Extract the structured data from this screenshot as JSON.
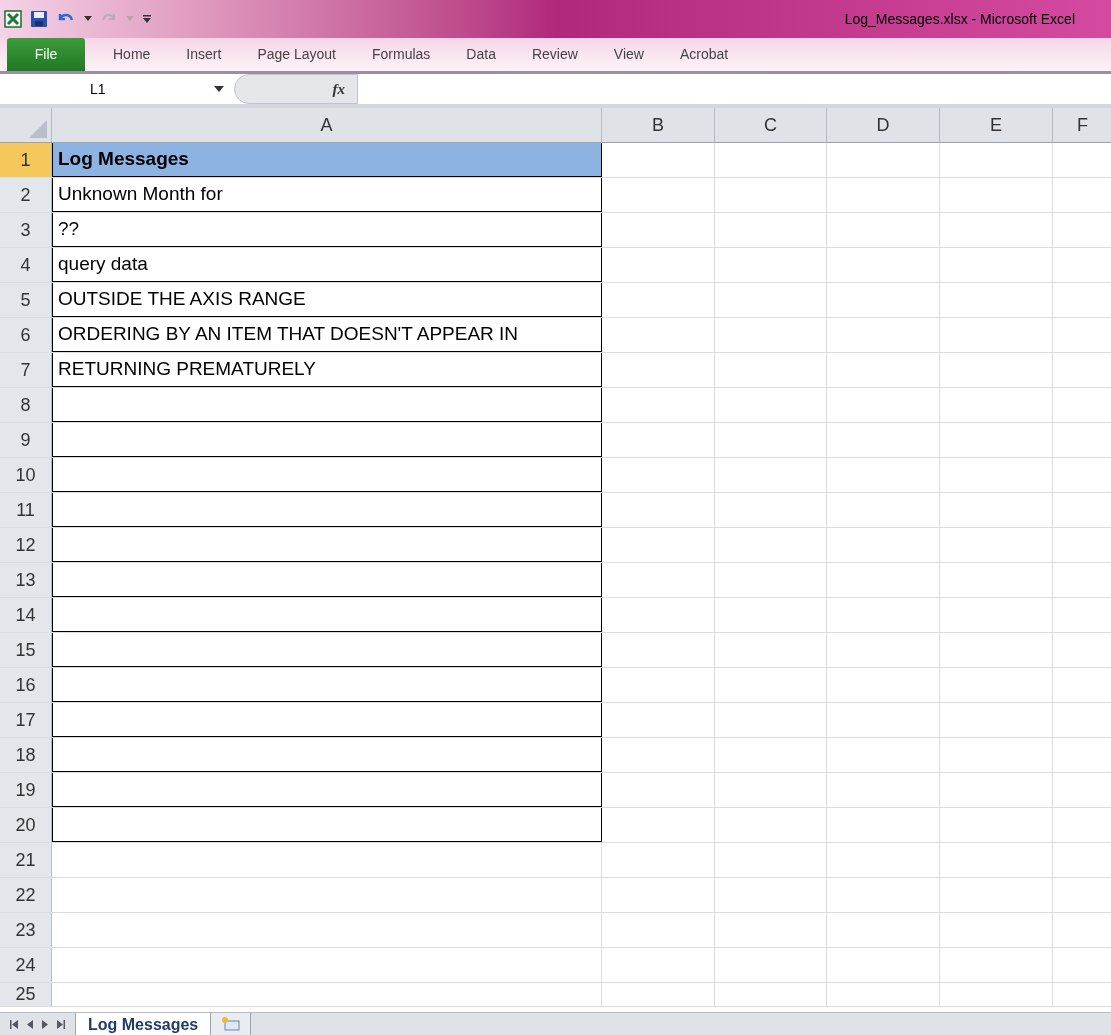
{
  "window": {
    "title": "Log_Messages.xlsx  -  Microsoft Excel"
  },
  "ribbon_tabs": [
    {
      "label": "File",
      "kind": "file",
      "selected": false
    },
    {
      "label": "Home",
      "kind": "tab",
      "selected": false
    },
    {
      "label": "Insert",
      "kind": "tab",
      "selected": false
    },
    {
      "label": "Page Layout",
      "kind": "tab",
      "selected": false
    },
    {
      "label": "Formulas",
      "kind": "tab",
      "selected": false
    },
    {
      "label": "Data",
      "kind": "tab",
      "selected": false
    },
    {
      "label": "Review",
      "kind": "tab",
      "selected": false
    },
    {
      "label": "View",
      "kind": "tab",
      "selected": false
    },
    {
      "label": "Acrobat",
      "kind": "tab",
      "selected": false
    }
  ],
  "formula_bar": {
    "name_box": "L1",
    "function_label": "fx"
  },
  "columns": [
    "A",
    "B",
    "C",
    "D",
    "E",
    "F"
  ],
  "rows": [
    {
      "number": "1",
      "selected": true,
      "header": true,
      "cell_a": "Log Messages",
      "bordered": true
    },
    {
      "number": "2",
      "selected": false,
      "header": false,
      "cell_a": "Unknown Month for",
      "bordered": true
    },
    {
      "number": "3",
      "selected": false,
      "header": false,
      "cell_a": "??",
      "bordered": true
    },
    {
      "number": "4",
      "selected": false,
      "header": false,
      "cell_a": "query data",
      "bordered": true
    },
    {
      "number": "5",
      "selected": false,
      "header": false,
      "cell_a": "OUTSIDE THE AXIS RANGE",
      "bordered": true
    },
    {
      "number": "6",
      "selected": false,
      "header": false,
      "cell_a": "ORDERING BY AN ITEM THAT DOESN'T APPEAR IN",
      "bordered": true
    },
    {
      "number": "7",
      "selected": false,
      "header": false,
      "cell_a": "RETURNING PREMATURELY",
      "bordered": true
    },
    {
      "number": "8",
      "selected": false,
      "header": false,
      "bordered": true
    },
    {
      "number": "9",
      "selected": false,
      "header": false,
      "bordered": true
    },
    {
      "number": "10",
      "selected": false,
      "header": false,
      "bordered": true
    },
    {
      "number": "11",
      "selected": false,
      "header": false,
      "bordered": true
    },
    {
      "number": "12",
      "selected": false,
      "header": false,
      "bordered": true
    },
    {
      "number": "13",
      "selected": false,
      "header": false,
      "bordered": true
    },
    {
      "number": "14",
      "selected": false,
      "header": false,
      "bordered": true
    },
    {
      "number": "15",
      "selected": false,
      "header": false,
      "bordered": true
    },
    {
      "number": "16",
      "selected": false,
      "header": false,
      "bordered": true
    },
    {
      "number": "17",
      "selected": false,
      "header": false,
      "bordered": true
    },
    {
      "number": "18",
      "selected": false,
      "header": false,
      "bordered": true
    },
    {
      "number": "19",
      "selected": false,
      "header": false,
      "bordered": true
    },
    {
      "number": "20",
      "selected": false,
      "header": false,
      "bordered": true
    },
    {
      "number": "21",
      "selected": false,
      "header": false,
      "bordered": false
    },
    {
      "number": "22",
      "selected": false,
      "header": false,
      "bordered": false
    },
    {
      "number": "23",
      "selected": false,
      "header": false,
      "bordered": false
    },
    {
      "number": "24",
      "selected": false,
      "header": false,
      "bordered": false
    },
    {
      "number": "25",
      "selected": false,
      "header": false,
      "bordered": false,
      "partial": true
    }
  ],
  "sheet_tabs": [
    {
      "label": "Log Messages",
      "selected": true
    }
  ]
}
